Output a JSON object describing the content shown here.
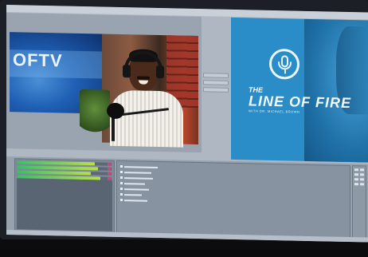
{
  "window": {
    "menu": [
      "",
      "",
      "",
      ""
    ],
    "title": ""
  },
  "program": {
    "logo_text": "OFTV"
  },
  "preview": {
    "title_line1": "THE",
    "title_line2": "LINE OF FIRE",
    "subtitle": "WITH DR. MICHAEL BROWN"
  },
  "colors": {
    "preview_bg": "#2b8dc7",
    "logo_bg": "#1f5fb4",
    "meter_green": "#3bbf6a",
    "meter_end": "#c64a7a"
  },
  "icons": [
    "microphone-icon"
  ],
  "meters": [
    {
      "level": 0.82
    },
    {
      "level": 0.86
    },
    {
      "level": 0.78
    },
    {
      "level": 0.88
    }
  ],
  "sources": [
    {
      "width": 0.35
    },
    {
      "width": 0.28
    },
    {
      "width": 0.3
    },
    {
      "width": 0.22
    },
    {
      "width": 0.26
    },
    {
      "width": 0.18
    },
    {
      "width": 0.24
    }
  ]
}
